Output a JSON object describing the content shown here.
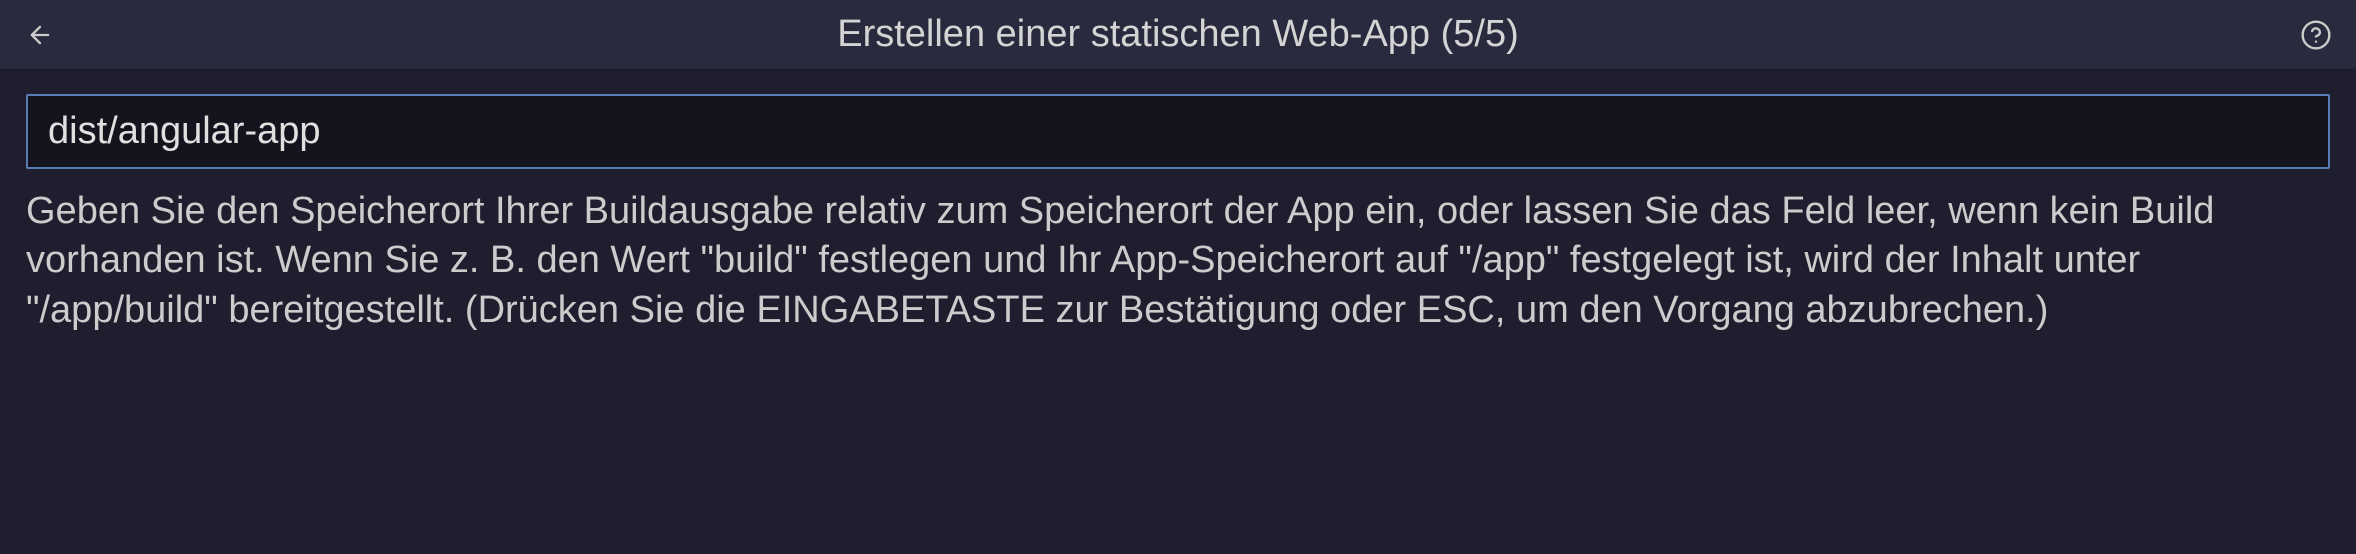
{
  "header": {
    "title": "Erstellen einer statischen Web-App (5/5)"
  },
  "input": {
    "value": "dist/angular-app",
    "placeholder": ""
  },
  "description": "Geben Sie den Speicherort Ihrer Buildausgabe relativ zum Speicherort der App ein, oder lassen Sie das Feld leer, wenn kein Build vorhanden ist. Wenn Sie z. B. den Wert \"build\" festlegen und Ihr App-Speicherort auf \"/app\" festgelegt ist, wird der Inhalt unter \"/app/build\" bereitgestellt. (Drücken Sie die EINGABETASTE zur Bestätigung oder ESC, um den Vorgang abzubrechen.)"
}
